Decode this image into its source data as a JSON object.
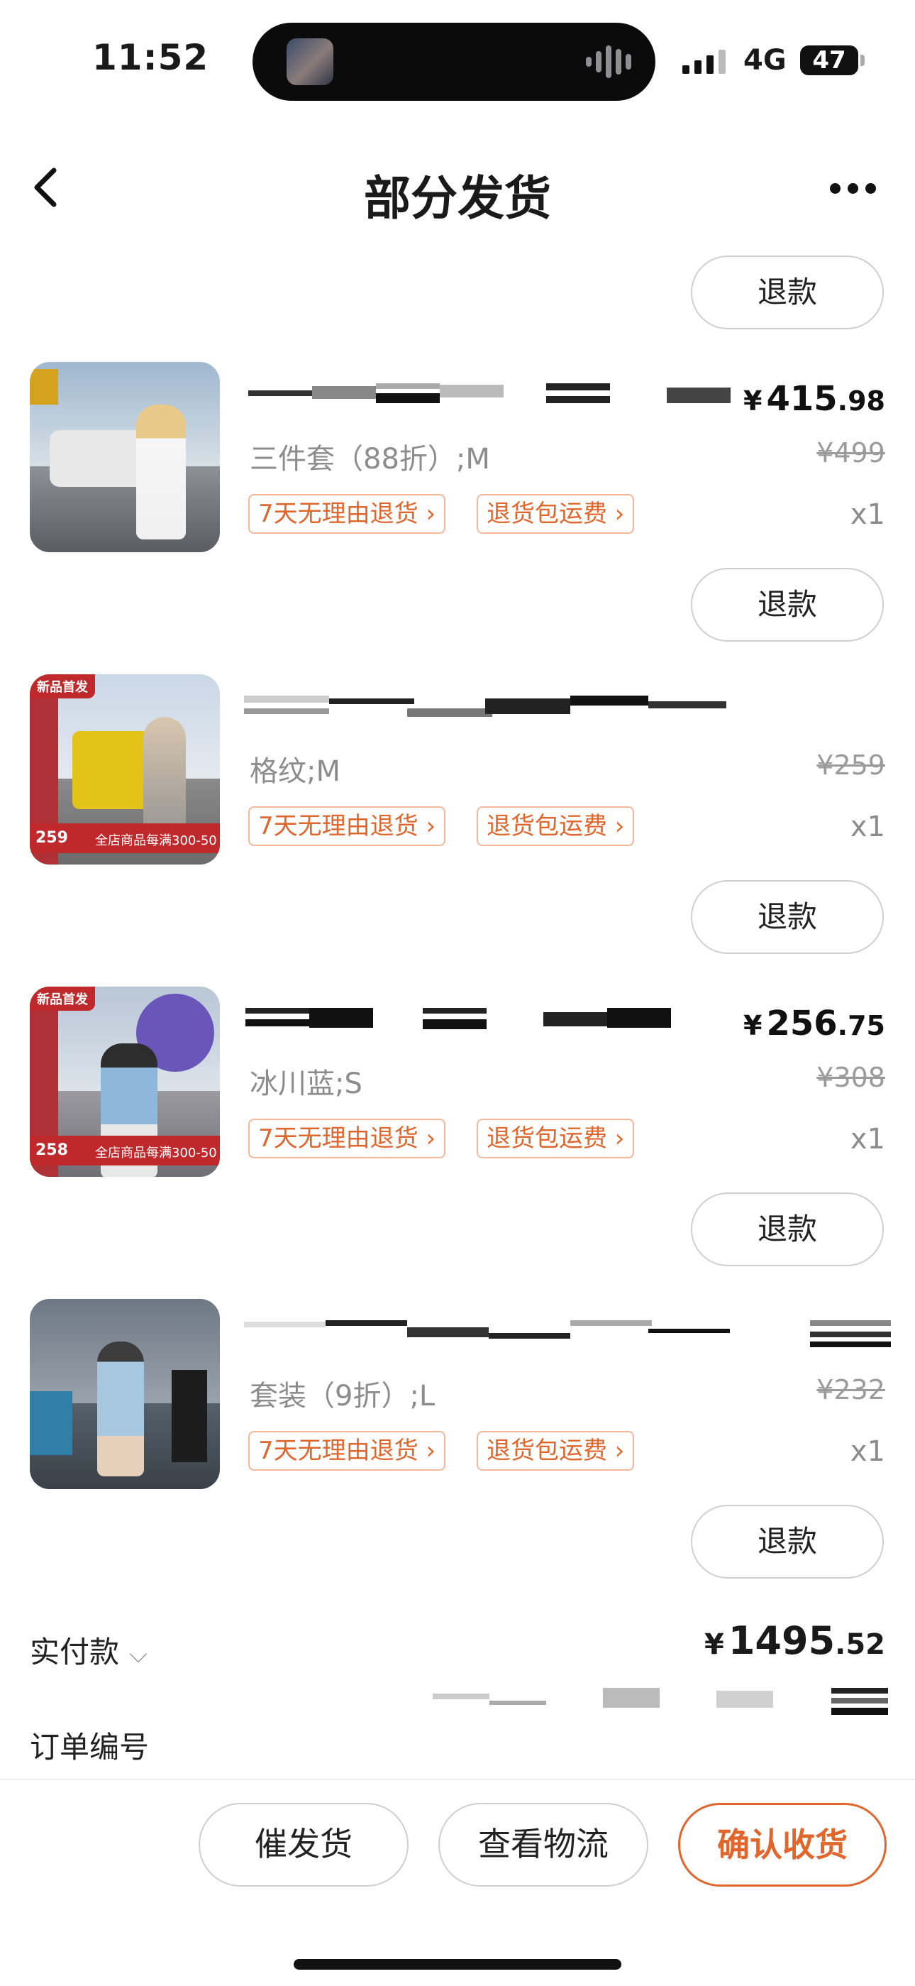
{
  "status_bar": {
    "time": "11:52",
    "network": "4G",
    "battery": "47"
  },
  "nav": {
    "title": "部分发货",
    "back_icon": "chevron-left",
    "more_icon": "ellipsis"
  },
  "refund_label": "退款",
  "items": [
    {
      "spec": "三件套（88折）;M",
      "price_symbol": "¥",
      "price_int": "415",
      "price_dec": ".98",
      "original_price": "¥499",
      "tags": [
        "7天无理由退货 ›",
        "退货包运费 ›"
      ],
      "qty": "x1"
    },
    {
      "spec": "格纹;M",
      "original_price": "¥259",
      "thumb_labels": {
        "badge": "新品首发",
        "price": "259",
        "promo": "全店商品每满300-50"
      },
      "tags": [
        "7天无理由退货 ›",
        "退货包运费 ›"
      ],
      "qty": "x1"
    },
    {
      "spec": "冰川蓝;S",
      "price_symbol": "¥",
      "price_int": "256",
      "price_dec": ".75",
      "original_price": "¥308",
      "thumb_labels": {
        "badge": "新品首发",
        "price": "258",
        "promo": "全店商品每满300-50"
      },
      "tags": [
        "7天无理由退货 ›",
        "退货包运费 ›"
      ],
      "qty": "x1"
    },
    {
      "spec": "套装（9折）;L",
      "original_price": "¥232",
      "tags": [
        "7天无理由退货 ›",
        "退货包运费 ›"
      ],
      "qty": "x1"
    }
  ],
  "summary": {
    "paid_label": "实付款",
    "paid_symbol": "¥",
    "paid_int": "1495",
    "paid_dec": ".52",
    "order_no_label": "订单编号"
  },
  "actions": {
    "urge": "催发货",
    "logistics": "查看物流",
    "confirm": "确认收货"
  },
  "colors": {
    "accent": "#e0662b",
    "tag_border": "#f3b89b",
    "muted": "#8c8c8c",
    "thumb_badge": "#c0292c"
  }
}
